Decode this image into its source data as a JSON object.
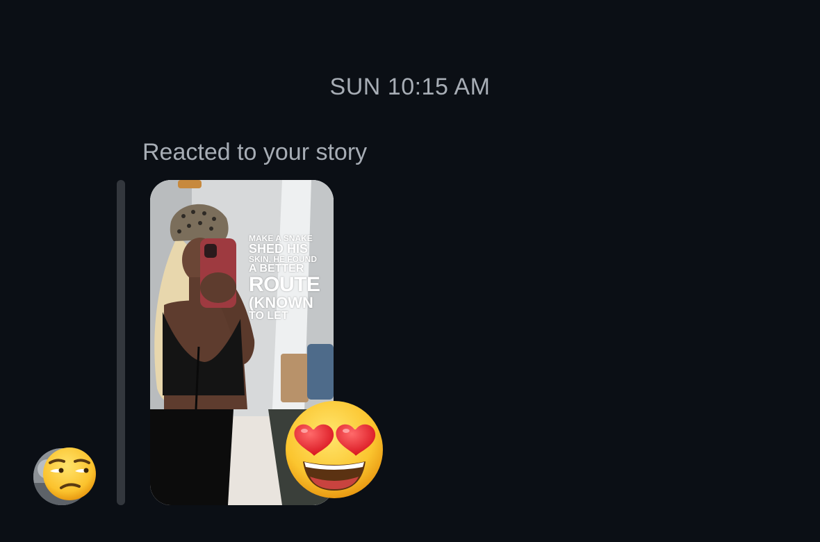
{
  "timestamp": "SUN 10:15 AM",
  "reaction_caption": "Reacted to your story",
  "story": {
    "text_lines": [
      "MAKE A SNAKE",
      "SHED HIS",
      "SKIN, HE FOUND",
      "A BETTER",
      "ROUTE",
      "(KNOWN",
      "TO LET"
    ]
  },
  "reaction_emoji_icon": "heart-eyes-emoji-icon",
  "sender_emoji_icon": "unamused-face-emoji-icon",
  "colors": {
    "background": "#0b0f15",
    "muted_text": "#a7adb5",
    "reply_bar": "#33373d"
  }
}
